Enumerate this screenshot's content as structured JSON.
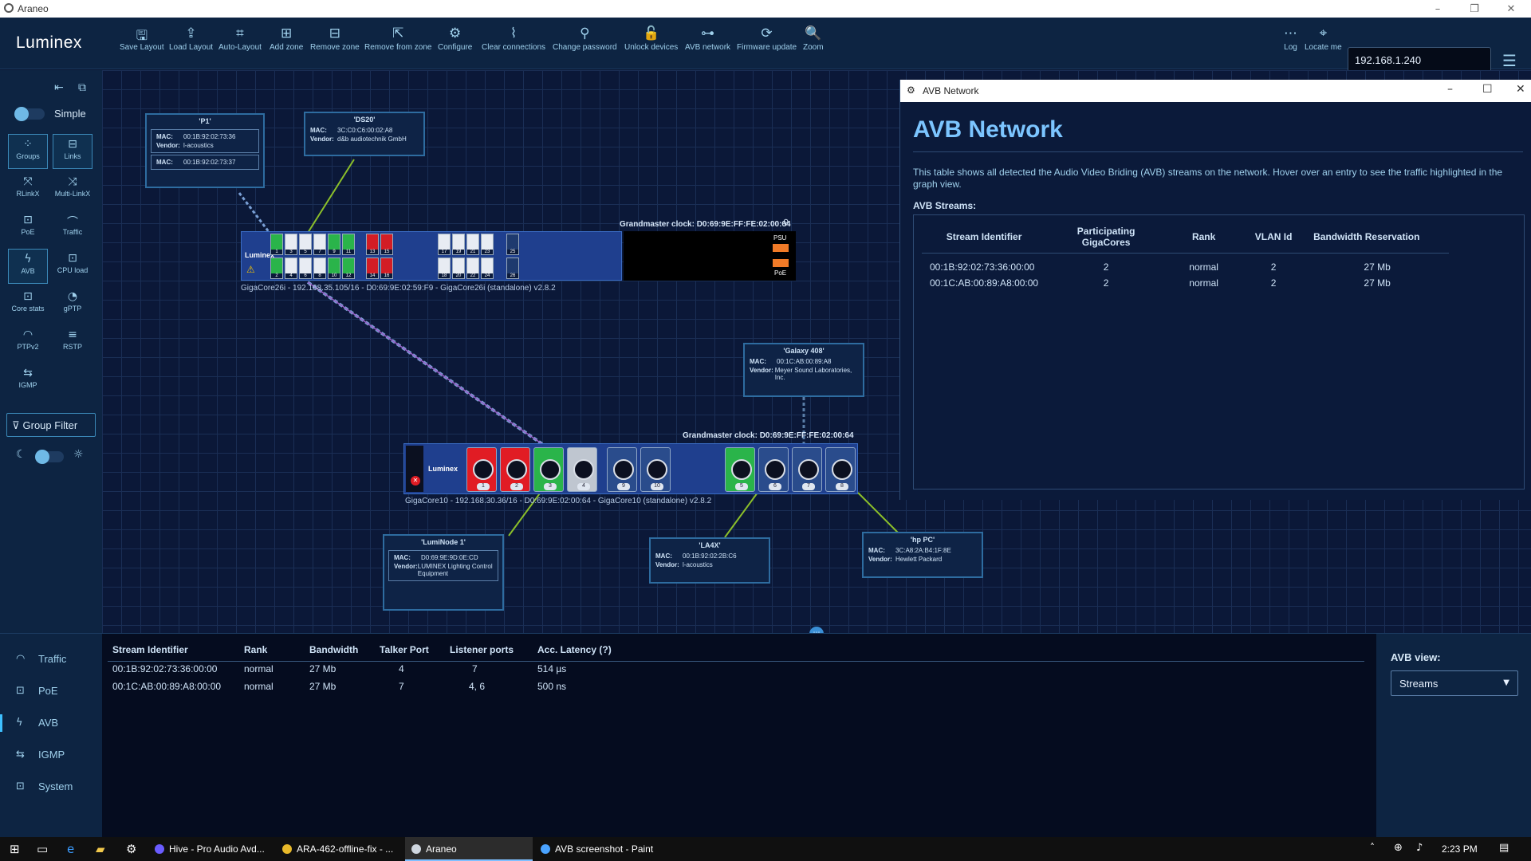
{
  "window": {
    "title": "Araneo",
    "minimize": "–",
    "maximize": "❐",
    "close": "✕"
  },
  "brand": "Luminex",
  "toolbar": {
    "buttons": [
      {
        "label": "Save Layout",
        "icon": "🖫"
      },
      {
        "label": "Load Layout",
        "icon": "⇪"
      },
      {
        "label": "Auto-Layout",
        "icon": "⌗"
      },
      {
        "label": "Add zone",
        "icon": "⊞"
      },
      {
        "label": "Remove zone",
        "icon": "⊟"
      },
      {
        "label": "Remove from zone",
        "icon": "⇱"
      },
      {
        "label": "Configure",
        "icon": "⚙"
      },
      {
        "label": "Clear connections",
        "icon": "⌇"
      },
      {
        "label": "Change password",
        "icon": "⚲"
      },
      {
        "label": "Unlock devices",
        "icon": "🔓"
      },
      {
        "label": "AVB network",
        "icon": "⊶"
      },
      {
        "label": "Firmware update",
        "icon": "⟳"
      },
      {
        "label": "Zoom",
        "icon": "🔍"
      }
    ],
    "log": {
      "label": "Log",
      "icon": "⋯"
    },
    "locate": {
      "label": "Locate me",
      "icon": "⌖"
    },
    "ip_value": "192.168.1.240",
    "menu_icon": "☰"
  },
  "sidebar": {
    "collapse_icon": "⇤",
    "popout_icon": "⧉",
    "mode_label": "Simple",
    "buttons": [
      {
        "label": "Groups",
        "icon": "⁘"
      },
      {
        "label": "Links",
        "icon": "⊟"
      },
      {
        "label": "RLinkX",
        "icon": "⤧"
      },
      {
        "label": "Multi-LinkX",
        "icon": "⤨"
      },
      {
        "label": "PoE",
        "icon": "⊡"
      },
      {
        "label": "Traffic",
        "icon": "⌒"
      },
      {
        "label": "AVB",
        "icon": "ϟ"
      },
      {
        "label": "CPU load",
        "icon": "⊡"
      },
      {
        "label": "Core stats",
        "icon": "⊡"
      },
      {
        "label": "gPTP",
        "icon": "◔"
      },
      {
        "label": "PTPv2",
        "icon": "◠"
      },
      {
        "label": "RSTP",
        "icon": "≡"
      },
      {
        "label": "IGMP",
        "icon": "⇆"
      }
    ],
    "group_filter": "Group Filter",
    "theme_dark_icon": "☾",
    "theme_light_icon": "☼"
  },
  "canvas": {
    "devices": [
      {
        "name": "'P1'",
        "rows": [
          [
            "MAC:",
            "00:1B:92:02:73:36"
          ],
          [
            "Vendor:",
            "l-acoustics"
          ]
        ],
        "extra_mac": "00:1B:92:02:73:37"
      },
      {
        "name": "'DS20'",
        "rows": [
          [
            "MAC:",
            "3C:C0:C6:00:02:A8"
          ],
          [
            "Vendor:",
            "d&b audiotechnik GmbH"
          ]
        ]
      },
      {
        "name": "'Galaxy 408'",
        "rows": [
          [
            "MAC:",
            "00:1C:AB:00:89:A8"
          ],
          [
            "Vendor:",
            "Meyer Sound Laboratories, Inc."
          ]
        ]
      },
      {
        "name": "'LumiNode 1'",
        "rows": [
          [
            "MAC:",
            "D0:69:9E:9D:0E:CD"
          ],
          [
            "Vendor:",
            "LUMINEX Lighting Control Equipment"
          ]
        ]
      },
      {
        "name": "'LA4X'",
        "rows": [
          [
            "MAC:",
            "00:1B:92:02:2B:C6"
          ],
          [
            "Vendor:",
            "l-acoustics"
          ]
        ]
      },
      {
        "name": "'hp PC'",
        "rows": [
          [
            "MAC:",
            "3C:A8:2A:B4:1F:8E"
          ],
          [
            "Vendor:",
            "Hewlett Packard"
          ]
        ]
      }
    ],
    "switch1": {
      "brand": "Luminex",
      "caption": "GigaCore26i - 192.168.35.105/16 - D0:69:9E:02:59:F9 - GigaCore26i (standalone) v2.8.2",
      "grandmaster": "Grandmaster clock: D0:69:9E:FF:FE:02:00:64",
      "psu": "PSU",
      "poe": "PoE",
      "ports": [
        "1",
        "2",
        "3",
        "4",
        "5",
        "6",
        "7",
        "8",
        "9",
        "10",
        "11",
        "12",
        "13",
        "14",
        "15",
        "16",
        "17",
        "18",
        "19",
        "20",
        "21",
        "22",
        "23",
        "24",
        "25",
        "26"
      ]
    },
    "switch2": {
      "brand": "Luminex",
      "caption": "GigaCore10 - 192.168.30.36/16 - D0:69:9E:02:00:64 - GigaCore10 (standalone) v2.8.2",
      "grandmaster": "Grandmaster clock: D0:69:9E:FF:FE:02:00:64",
      "ports": [
        "1",
        "2",
        "3",
        "4",
        "9",
        "10",
        "5",
        "6",
        "7",
        "8"
      ]
    }
  },
  "avb_window": {
    "title": "AVB Network",
    "heading": "AVB Network",
    "description": "This table shows all detected the Audio Video Briding (AVB) streams on the network. Hover over an entry to see the traffic highlighted in the graph view.",
    "streams_label": "AVB Streams:",
    "columns": [
      "Stream Identifier",
      "Participating GigaCores",
      "Rank",
      "VLAN Id",
      "Bandwidth Reservation"
    ],
    "rows": [
      [
        "00:1B:92:02:73:36:00:00",
        "2",
        "normal",
        "2",
        "27 Mb"
      ],
      [
        "00:1C:AB:00:89:A8:00:00",
        "2",
        "normal",
        "2",
        "27 Mb"
      ]
    ]
  },
  "bottom": {
    "nav": [
      {
        "label": "Traffic",
        "icon": "◠"
      },
      {
        "label": "PoE",
        "icon": "⊡"
      },
      {
        "label": "AVB",
        "icon": "ϟ"
      },
      {
        "label": "IGMP",
        "icon": "⇆"
      },
      {
        "label": "System",
        "icon": "⊡"
      }
    ],
    "columns": [
      "Stream Identifier",
      "Rank",
      "Bandwidth",
      "Talker Port",
      "Listener ports",
      "Acc. Latency (?)"
    ],
    "rows": [
      [
        "00:1B:92:02:73:36:00:00",
        "normal",
        "27 Mb",
        "4",
        "7",
        "514 µs"
      ],
      [
        "00:1C:AB:00:89:A8:00:00",
        "normal",
        "27 Mb",
        "7",
        "4, 6",
        "500 ns"
      ]
    ],
    "view_label": "AVB view:",
    "view_value": "Streams",
    "splitter_icon": "⋯"
  },
  "taskbar": {
    "start_icon": "⊞",
    "items": [
      "Hive - Pro Audio Avd...",
      "ARA-462-offline-fix - ...",
      "Araneo",
      "AVB screenshot - Paint"
    ],
    "time": "2:23 PM"
  },
  "colors": {
    "accent": "#3ec0ff",
    "port_red": "#d31d25",
    "port_green": "#2ab44a",
    "switch_blue": "#1f3f8e"
  }
}
